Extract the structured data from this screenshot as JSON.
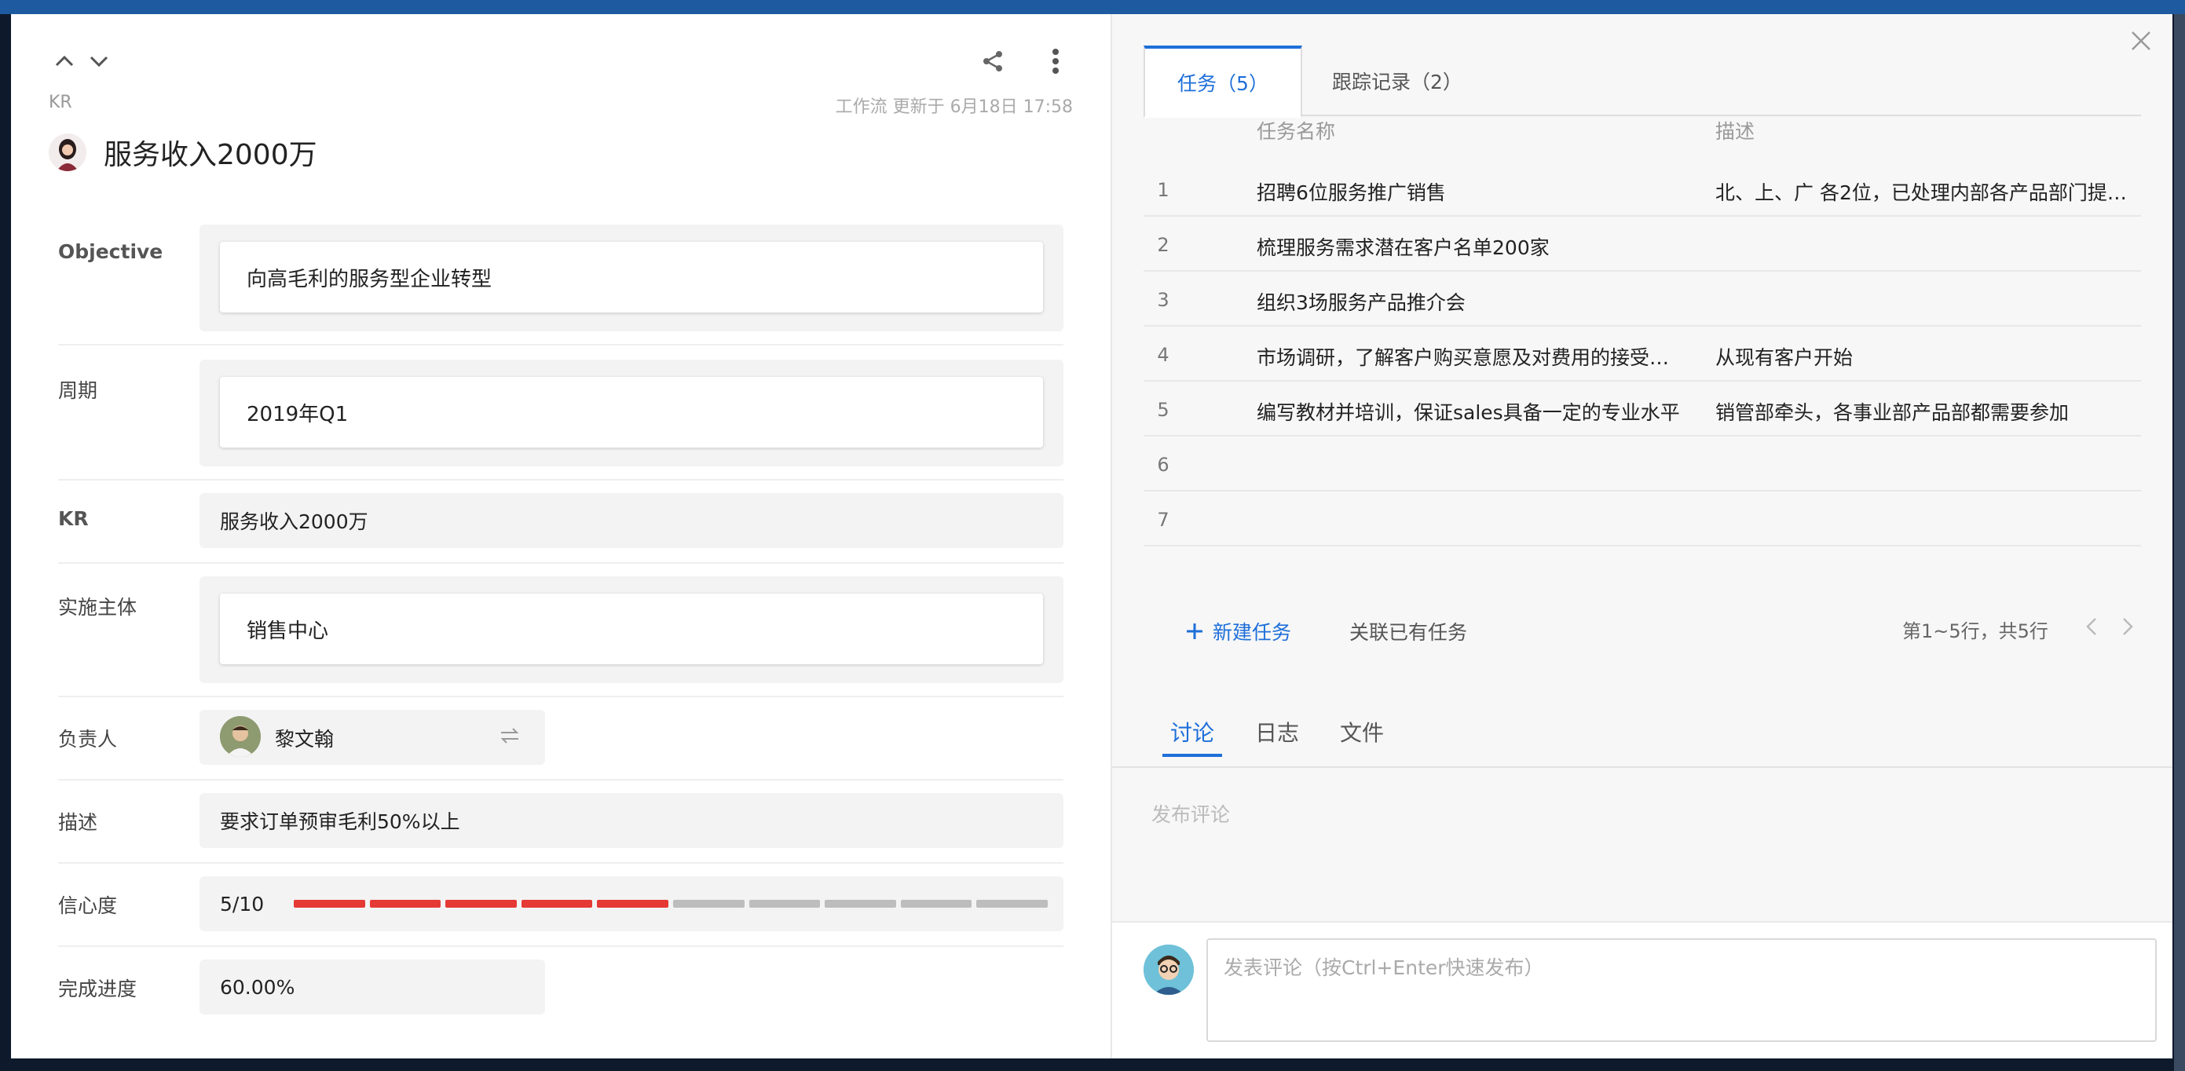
{
  "header": {
    "kr_tag": "KR",
    "meta": "工作流 更新于 6月18日 17:58",
    "title": "服务收入2000万"
  },
  "fields": {
    "objective": {
      "label": "Objective",
      "value": "向高毛利的服务型企业转型"
    },
    "period": {
      "label": "周期",
      "value": "2019年Q1"
    },
    "kr": {
      "label": "KR",
      "value": "服务收入2000万"
    },
    "owner_org": {
      "label": "实施主体",
      "value": "销售中心"
    },
    "assignee": {
      "label": "负责人",
      "value": "黎文翰"
    },
    "description": {
      "label": "描述",
      "value": "要求订单预审毛利50%以上"
    },
    "confidence": {
      "label": "信心度",
      "value_text": "5/10",
      "value": 5,
      "max": 10,
      "active_color": "#e53935",
      "inactive_color": "#bdbdbd"
    },
    "progress": {
      "label": "完成进度",
      "value": "60.00%"
    }
  },
  "tasks_panel": {
    "tabs": [
      {
        "label": "任务（5）"
      },
      {
        "label": "跟踪记录（2）"
      }
    ],
    "columns": {
      "name": "任务名称",
      "desc": "描述"
    },
    "rows": [
      {
        "num": "1",
        "name": "招聘6位服务推广销售",
        "desc": "北、上、广 各2位，已处理内部各产品部门提…"
      },
      {
        "num": "2",
        "name": "梳理服务需求潜在客户名单200家",
        "desc": ""
      },
      {
        "num": "3",
        "name": "组织3场服务产品推介会",
        "desc": ""
      },
      {
        "num": "4",
        "name": "市场调研，了解客户购买意愿及对费用的接受…",
        "desc": "从现有客户开始"
      },
      {
        "num": "5",
        "name": "编写教材并培训，保证sales具备一定的专业水平",
        "desc": "销管部牵头，各事业部产品部都需要参加"
      },
      {
        "num": "6",
        "name": "",
        "desc": ""
      },
      {
        "num": "7",
        "name": "",
        "desc": ""
      }
    ],
    "new_task": "新建任务",
    "link_task": "关联已有任务",
    "pager": "第1~5行，共5行"
  },
  "discussion": {
    "tabs": [
      {
        "label": "讨论"
      },
      {
        "label": "日志"
      },
      {
        "label": "文件"
      }
    ],
    "post_hint": "发布评论",
    "comment_placeholder": "发表评论（按Ctrl+Enter快速发布）"
  },
  "colors": {
    "accent": "#1e6fd9",
    "confidence_red": "#e53935"
  }
}
